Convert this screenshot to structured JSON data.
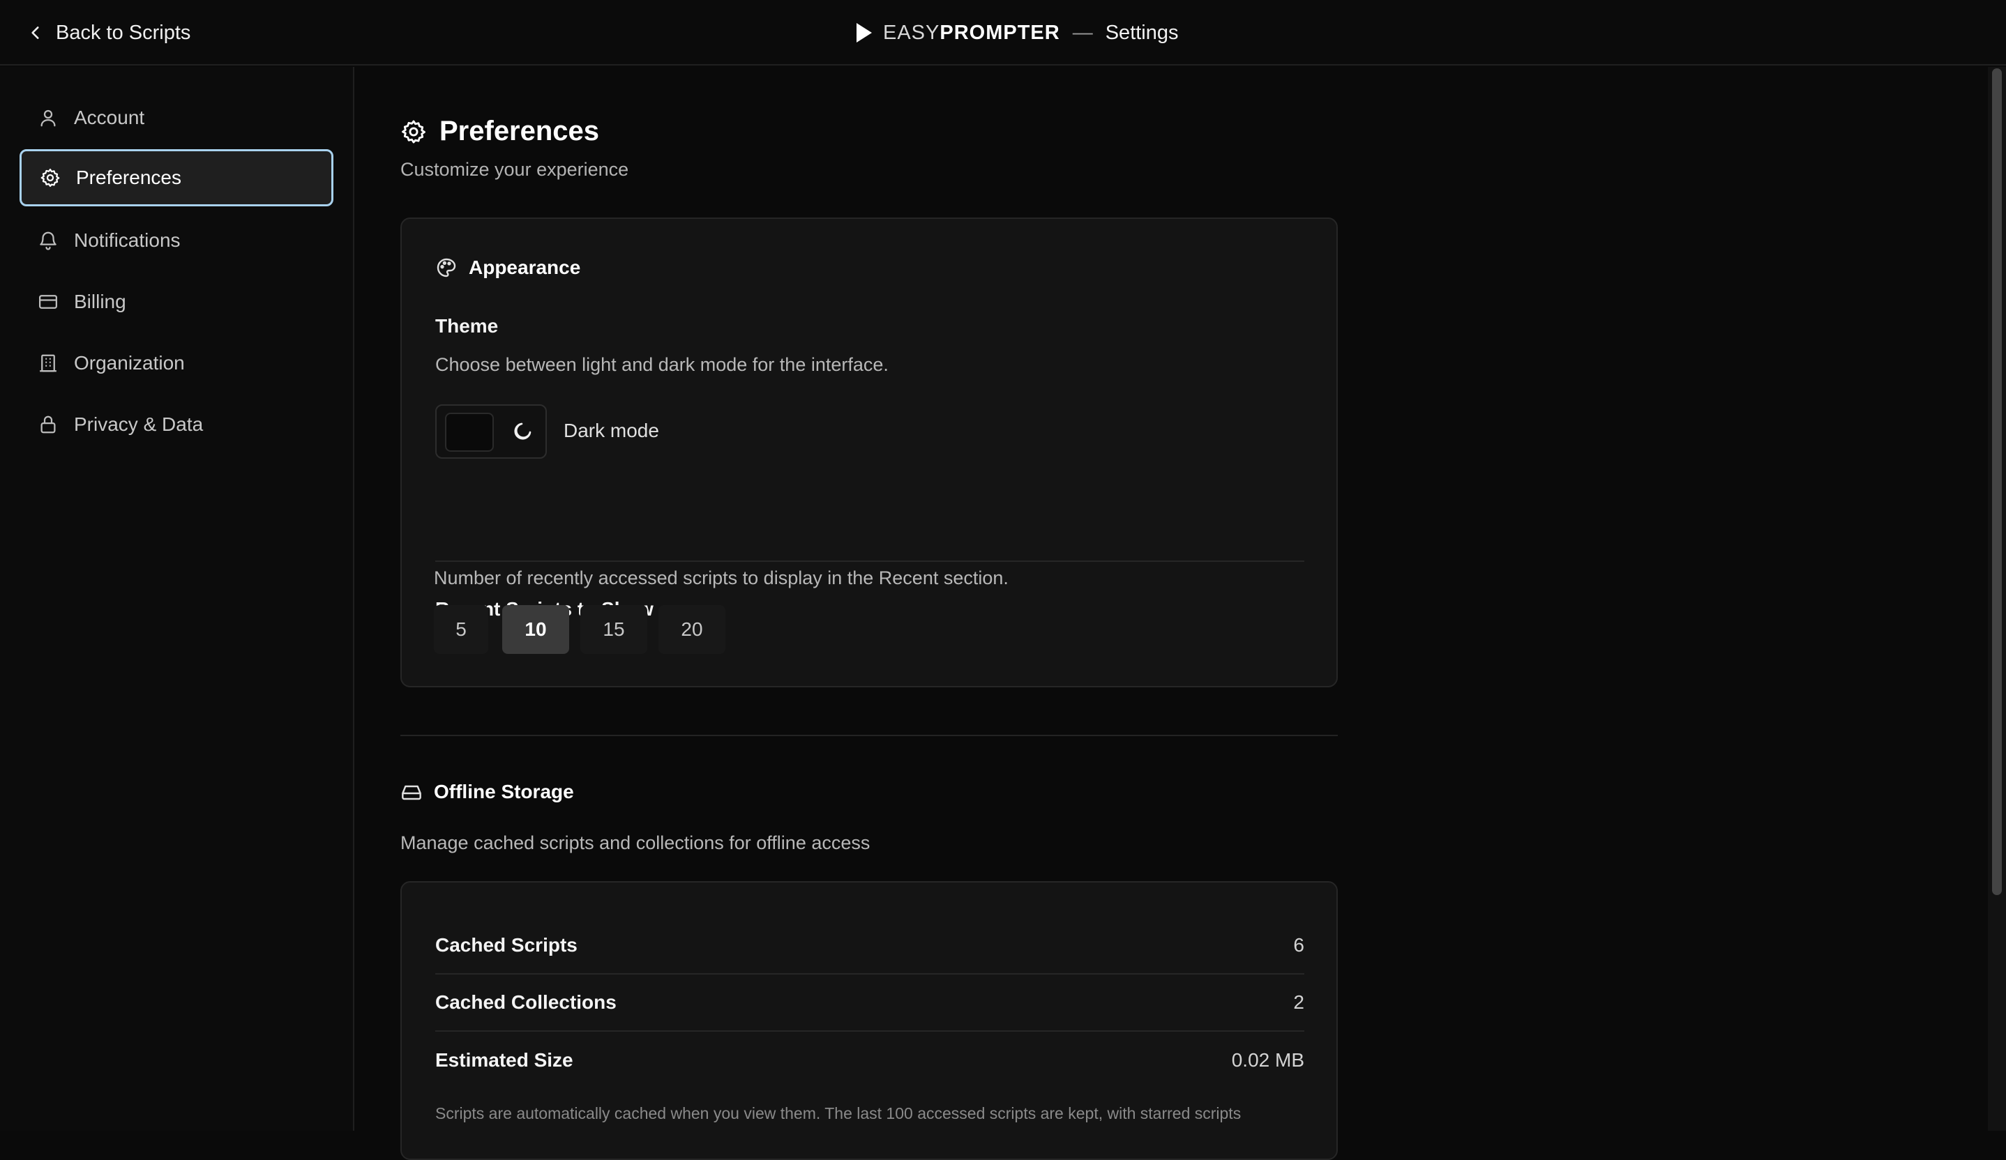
{
  "header": {
    "back_label": "Back to Scripts",
    "brand_easy": "EASY",
    "brand_prompter": "PROMPTER",
    "separator": "—",
    "section": "Settings"
  },
  "sidebar": {
    "items": [
      {
        "label": "Account",
        "icon": "user-icon"
      },
      {
        "label": "Preferences",
        "icon": "gear-icon",
        "active": true
      },
      {
        "label": "Notifications",
        "icon": "bell-icon"
      },
      {
        "label": "Billing",
        "icon": "credit-card-icon"
      },
      {
        "label": "Organization",
        "icon": "building-icon"
      },
      {
        "label": "Privacy & Data",
        "icon": "lock-icon"
      }
    ]
  },
  "page": {
    "title": "Preferences",
    "subtitle": "Customize your experience"
  },
  "appearance": {
    "heading": "Appearance",
    "theme_label": "Theme",
    "theme_desc": "Choose between light and dark mode for the interface.",
    "toggle_label": "Dark mode",
    "toggle_on": true,
    "recent_label": "Recent Scripts to Show",
    "recent_desc": "Number of recently accessed scripts to display in the Recent section.",
    "recent_options": [
      "5",
      "10",
      "15",
      "20"
    ],
    "recent_selected": "10"
  },
  "offline": {
    "heading": "Offline Storage",
    "desc": "Manage cached scripts and collections for offline access",
    "stats": [
      {
        "label": "Cached Scripts",
        "value": "6"
      },
      {
        "label": "Cached Collections",
        "value": "2"
      },
      {
        "label": "Estimated Size",
        "value": "0.02 MB"
      }
    ],
    "note": "Scripts are automatically cached when you view them. The last 100 accessed scripts are kept, with starred scripts"
  },
  "colors": {
    "active_border": "#a9d2ee",
    "background": "#0a0a0a",
    "card": "#141414"
  }
}
